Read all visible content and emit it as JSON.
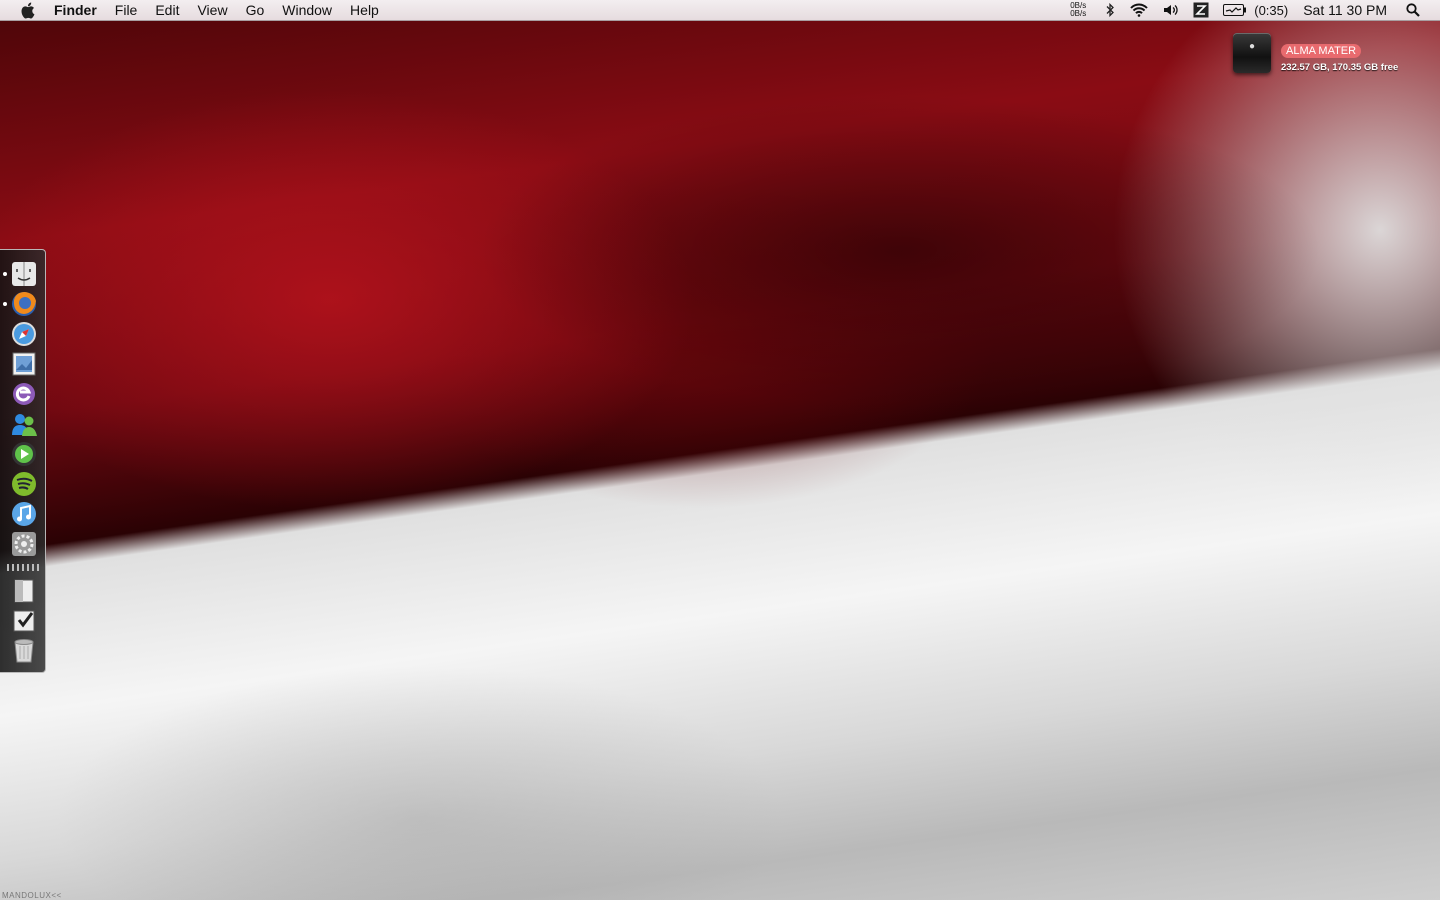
{
  "menubar": {
    "app_name": "Finder",
    "menus": [
      "File",
      "Edit",
      "View",
      "Go",
      "Window",
      "Help"
    ],
    "net_up": "0B/s",
    "net_down": "0B/s",
    "battery_time": "(0:35)",
    "clock": "Sat 11 30 PM"
  },
  "drive": {
    "name": "ALMA MATER",
    "info": "232.57 GB, 170.35 GB free"
  },
  "dock": {
    "items": [
      {
        "name": "finder-icon",
        "running": true
      },
      {
        "name": "firefox-icon",
        "running": true
      },
      {
        "name": "safari-icon",
        "running": false
      },
      {
        "name": "preview-icon",
        "running": false
      },
      {
        "name": "entourage-icon",
        "running": false
      },
      {
        "name": "messenger-icon",
        "running": false
      },
      {
        "name": "media-player-icon",
        "running": false
      },
      {
        "name": "spotify-icon",
        "running": false
      },
      {
        "name": "itunes-icon",
        "running": false
      },
      {
        "name": "system-preferences-icon",
        "running": false
      },
      {
        "name": "documents-stack-icon",
        "running": false
      },
      {
        "name": "downloads-stack-icon",
        "running": false
      },
      {
        "name": "trash-icon",
        "running": false
      }
    ]
  },
  "watermark": "MANDOLUX<<",
  "colors": {
    "menubar": "#ece4e6",
    "drive_badge": "#e86a6e",
    "dock_bg": "#1e1e1e"
  }
}
